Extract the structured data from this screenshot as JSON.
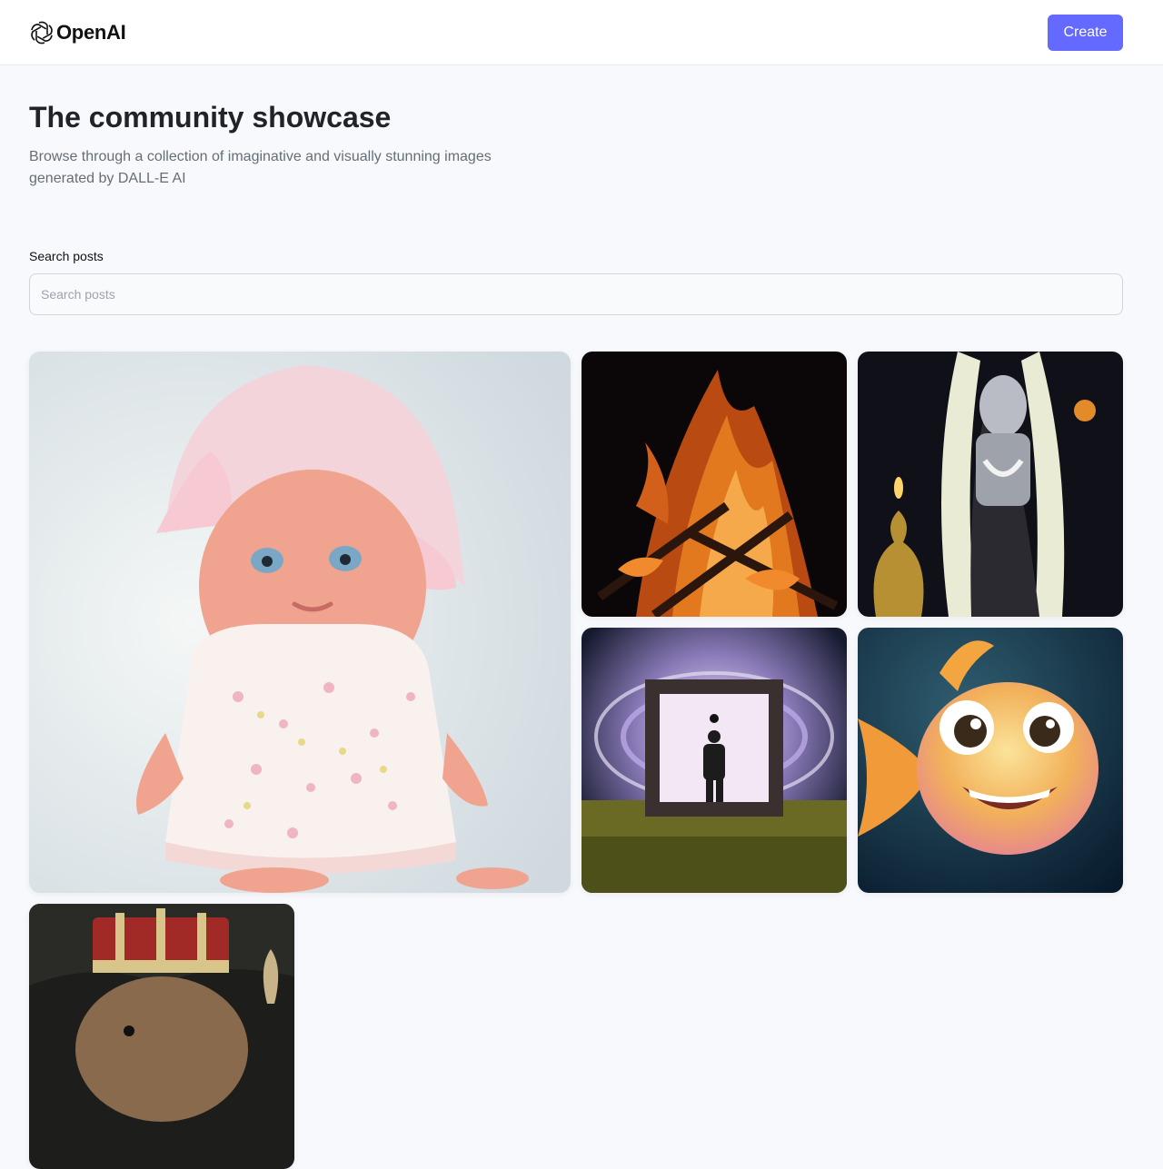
{
  "header": {
    "logo_text": "OpenAI",
    "create_label": "Create",
    "accent_color": "#6469ff"
  },
  "hero": {
    "title": "The community showcase",
    "subtitle": "Browse through a collection of imaginative and visually stunning images generated by DALL-E AI"
  },
  "search": {
    "label": "Search posts",
    "placeholder": "Search posts",
    "value": ""
  },
  "gallery": {
    "items": [
      {
        "subject": "baby-doll-pink-bonnet"
      },
      {
        "subject": "campfire-flames"
      },
      {
        "subject": "deity-statue-garland"
      },
      {
        "subject": "person-before-portal"
      },
      {
        "subject": "cartoon-goldfish"
      },
      {
        "subject": "capybara-with-crown"
      }
    ]
  }
}
